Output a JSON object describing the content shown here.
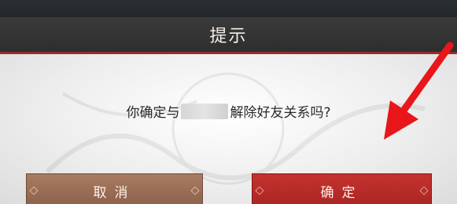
{
  "dialog": {
    "title": "提示",
    "message_prefix": "你确定与",
    "message_suffix": "解除好友关系吗?",
    "cancel_label": "取消",
    "confirm_label": "确定"
  },
  "colors": {
    "title_bar": "#333334",
    "accent_red": "#9a2a26",
    "cancel_button": "#9a6e56",
    "confirm_button": "#b72b28",
    "annotation_arrow": "#e8161a"
  },
  "icons": {
    "annotation": "red-arrow-icon"
  }
}
